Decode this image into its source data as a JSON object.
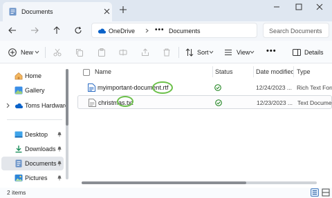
{
  "tab": {
    "title": "Documents"
  },
  "address": {
    "root": "OneDrive",
    "more": "•••",
    "current": "Documents"
  },
  "search": {
    "placeholder": "Search Documents"
  },
  "toolbar": {
    "new_label": "New",
    "sort_label": "Sort",
    "view_label": "View",
    "more_label": "•••",
    "details_label": "Details"
  },
  "sidebar": {
    "items": [
      {
        "label": "Home",
        "icon": "home-icon"
      },
      {
        "label": "Gallery",
        "icon": "gallery-icon"
      },
      {
        "label": "Toms Hardware",
        "icon": "cloud-folder-icon"
      },
      {
        "label": "Desktop",
        "icon": "desktop-icon"
      },
      {
        "label": "Downloads",
        "icon": "download-icon"
      },
      {
        "label": "Documents",
        "icon": "documents-icon"
      },
      {
        "label": "Pictures",
        "icon": "pictures-icon"
      }
    ]
  },
  "columns": {
    "name": "Name",
    "status": "Status",
    "date": "Date modified",
    "type": "Type"
  },
  "files": [
    {
      "name": "myimportant-document.rtf",
      "date": "12/24/2023 ...",
      "type": "Rich Text Form",
      "icon": "rtf-file-icon",
      "status": "synced-icon"
    },
    {
      "name": "christmas.txt",
      "date": "12/23/2023 ...",
      "type": "Text Document",
      "icon": "txt-file-icon",
      "status": "synced-icon"
    }
  ],
  "statusbar": {
    "count": "2 items"
  },
  "colors": {
    "accent": "#0067c0",
    "highlight": "#6cc04a",
    "synced": "#0f7b0f"
  }
}
